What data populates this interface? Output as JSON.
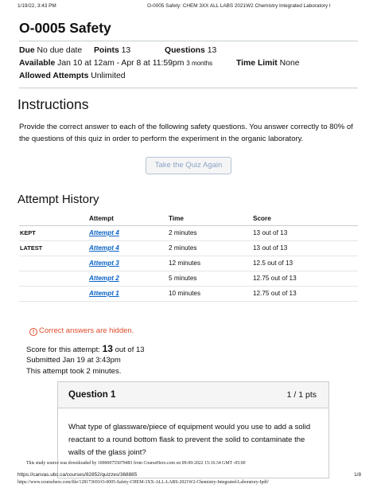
{
  "print_header": {
    "datetime": "1/19/22, 3:43 PM",
    "title": "O-0005 Safety: CHEM 3XX ALL LABS 2021W2 Chemistry Integrated Laboratory I"
  },
  "quiz": {
    "title": "O-0005 Safety",
    "due_label": "Due",
    "due_value": "No due date",
    "points_label": "Points",
    "points_value": "13",
    "questions_label": "Questions",
    "questions_value": "13",
    "available_label": "Available",
    "available_value": "Jan 10 at 12am - Apr 8 at 11:59pm",
    "available_duration": "3 months",
    "time_limit_label": "Time Limit",
    "time_limit_value": "None",
    "allowed_attempts_label": "Allowed Attempts",
    "allowed_attempts_value": "Unlimited"
  },
  "instructions": {
    "title": "Instructions",
    "text": "Provide the correct answer to each of the following safety questions. You answer correctly to 80% of the questions of this quiz in order to perform the experiment in the organic laboratory.",
    "retake_button": "Take the Quiz Again"
  },
  "attempt_history": {
    "title": "Attempt History",
    "headers": [
      "",
      "Attempt",
      "Time",
      "Score"
    ],
    "rows": [
      {
        "tag": "KEPT",
        "attempt": "Attempt 4",
        "time": "2 minutes",
        "score": "13 out of 13"
      },
      {
        "tag": "LATEST",
        "attempt": "Attempt 4",
        "time": "2 minutes",
        "score": "13 out of 13"
      },
      {
        "tag": "",
        "attempt": "Attempt 3",
        "time": "12 minutes",
        "score": "12.5 out of 13"
      },
      {
        "tag": "",
        "attempt": "Attempt 2",
        "time": "5 minutes",
        "score": "12.75 out of 13"
      },
      {
        "tag": "",
        "attempt": "Attempt 1",
        "time": "10 minutes",
        "score": "12.75 out of 13"
      }
    ]
  },
  "result": {
    "hidden_notice": "Correct answers are hidden.",
    "score_prefix": "Score for this attempt:",
    "score_value": "13",
    "score_suffix": "out of 13",
    "submitted": "Submitted Jan 19 at 3:43pm",
    "duration": "This attempt took 2 minutes."
  },
  "question": {
    "title": "Question 1",
    "points": "1 / 1 pts",
    "text": "What type of glassware/piece of equipment would you use to add a solid reactant to a round bottom flask to prevent the solid to contaminate the walls of the glass joint?"
  },
  "footer": {
    "source_note": "This study source was downloaded by 100000755079483 from CourseHero.com on 09-09-2022 15:16:34 GMT -05:00",
    "url": "https://canvas.ubc.ca/courses/82852/quizzes/368885",
    "page": "1/8",
    "coursehero_url": "https://www.coursehero.com/file/128173693/O-0005-Safety-CHEM-3XX-ALL-LABS-2021W2-Chemistry-Integrated-Laboratory-Ipdf/"
  },
  "colors": {
    "link": "#0a63c6",
    "warning": "#e14b2b",
    "button_text": "#8aa4c8"
  }
}
